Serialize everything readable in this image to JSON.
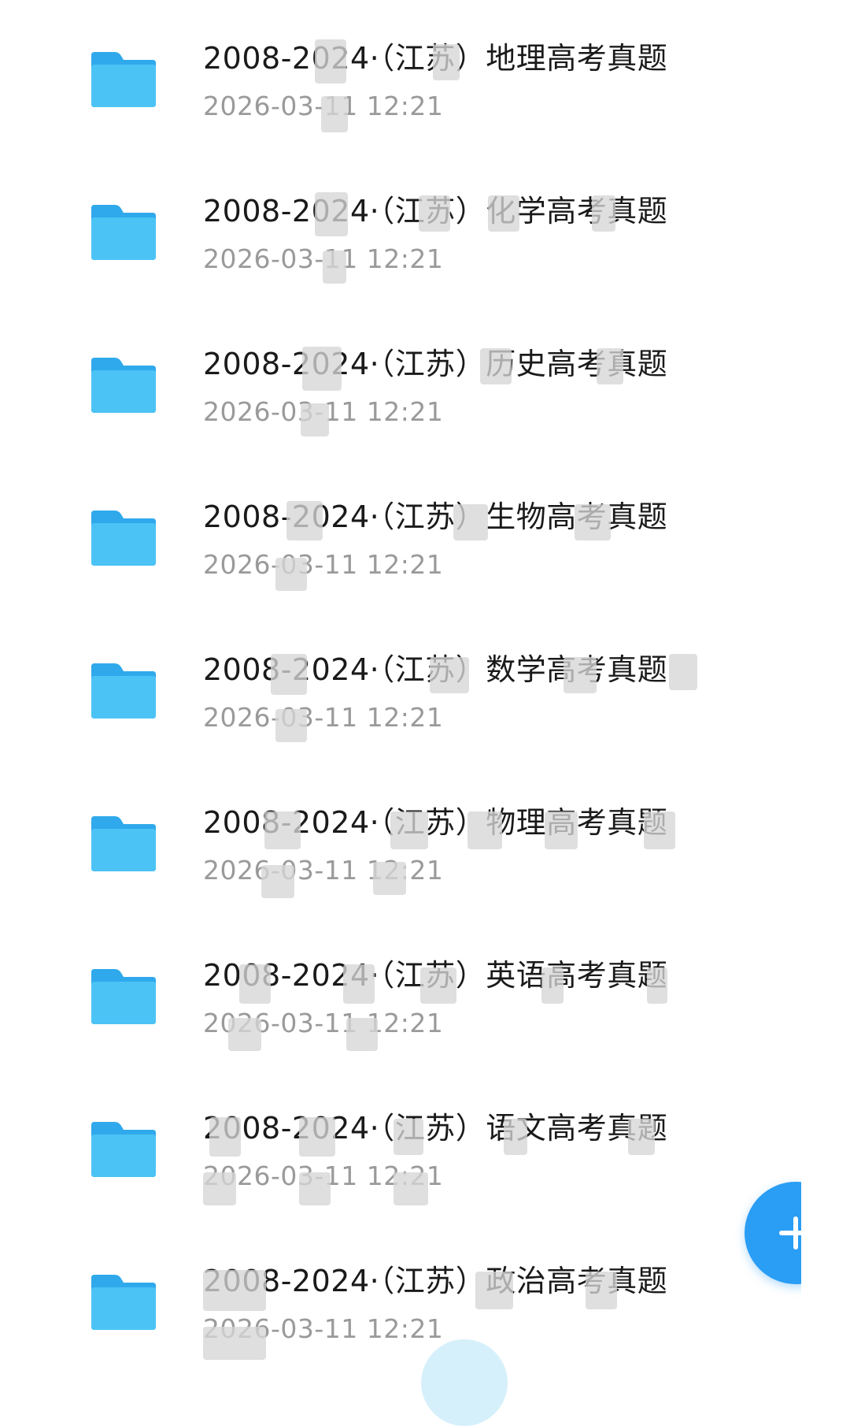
{
  "folders": [
    {
      "name": "2008-2024·（江苏）地理高考真题",
      "modified": "2026-03-11  12:21"
    },
    {
      "name": "2008-2024·（江苏）化学高考真题",
      "modified": "2026-03-11  12:21"
    },
    {
      "name": "2008-2024·（江苏）历史高考真题",
      "modified": "2026-03-11  12:21"
    },
    {
      "name": "2008-2024·（江苏）生物高考真题",
      "modified": "2026-03-11  12:21"
    },
    {
      "name": "2008-2024·（江苏）数学高考真题",
      "modified": "2026-03-11  12:21"
    },
    {
      "name": "2008-2024·（江苏）物理高考真题",
      "modified": "2026-03-11  12:21"
    },
    {
      "name": "2008-2024·（江苏）英语高考真题",
      "modified": "2026-03-11  12:21"
    },
    {
      "name": "2008-2024·（江苏）语文高考真题",
      "modified": "2026-03-11  12:21"
    },
    {
      "name": "2008-2024·（江苏）政治高考真题",
      "modified": "2026-03-11  12:21"
    }
  ],
  "icons": {
    "folder": "folder-icon",
    "fab": "plus-icon"
  },
  "colors": {
    "folder_blue": "#4cc3f5",
    "folder_tab_blue": "#2fa9ec",
    "fab_blue": "#2a9df4",
    "meta_gray": "#9a9a9a"
  }
}
